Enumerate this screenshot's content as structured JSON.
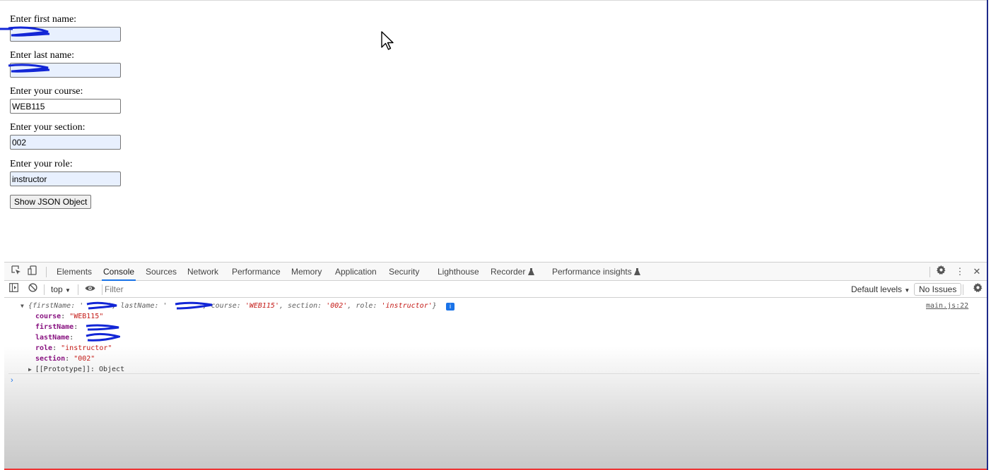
{
  "form": {
    "first_name_label": "Enter first name:",
    "first_name_value": "",
    "last_name_label": "Enter last name:",
    "last_name_value": "",
    "course_label": "Enter your course:",
    "course_value": "WEB115",
    "section_label": "Enter your section:",
    "section_value": "002",
    "role_label": "Enter your role:",
    "role_value": "instructor",
    "show_button_label": "Show JSON Object"
  },
  "devtools": {
    "tabs": [
      "Elements",
      "Console",
      "Sources",
      "Network",
      "Performance",
      "Memory",
      "Application",
      "Security",
      "Lighthouse",
      "Recorder",
      "Performance insights"
    ],
    "active_tab": "Console",
    "toolbar": {
      "context": "top",
      "filter_placeholder": "Filter",
      "default_levels": "Default levels",
      "no_issues": "No Issues"
    },
    "console_log": {
      "source_link": "main.js:22",
      "summary": {
        "open": "{firstName: '",
        "mid1": "', lastName: '",
        "mid2": "', course: ",
        "course": "'WEB115'",
        "section_key": ", section: ",
        "section": "'002'",
        "role_key": ", role: ",
        "role": "'instructor'",
        "close": "}"
      },
      "properties": [
        {
          "key": "course",
          "value": "\"WEB115\""
        },
        {
          "key": "firstName",
          "value": ""
        },
        {
          "key": "lastName",
          "value": ""
        },
        {
          "key": "role",
          "value": "\"instructor\""
        },
        {
          "key": "section",
          "value": "\"002\""
        }
      ],
      "prototype_label": "[[Prototype]]",
      "prototype_value": "Object"
    }
  },
  "colors": {
    "autofill_bg": "#e8f0fe",
    "active_tab_underline": "#1a73e8",
    "string_value": "#c41a16",
    "property_key": "#881280",
    "scribble": "#1226d6"
  },
  "icons": [
    "inspect-element-icon",
    "device-toolbar-icon",
    "sidebar-toggle-icon",
    "clear-console-icon",
    "eye-icon",
    "gear-icon",
    "more-vert-icon",
    "close-icon",
    "flask-icon",
    "mouse-cursor-icon",
    "info-icon"
  ]
}
